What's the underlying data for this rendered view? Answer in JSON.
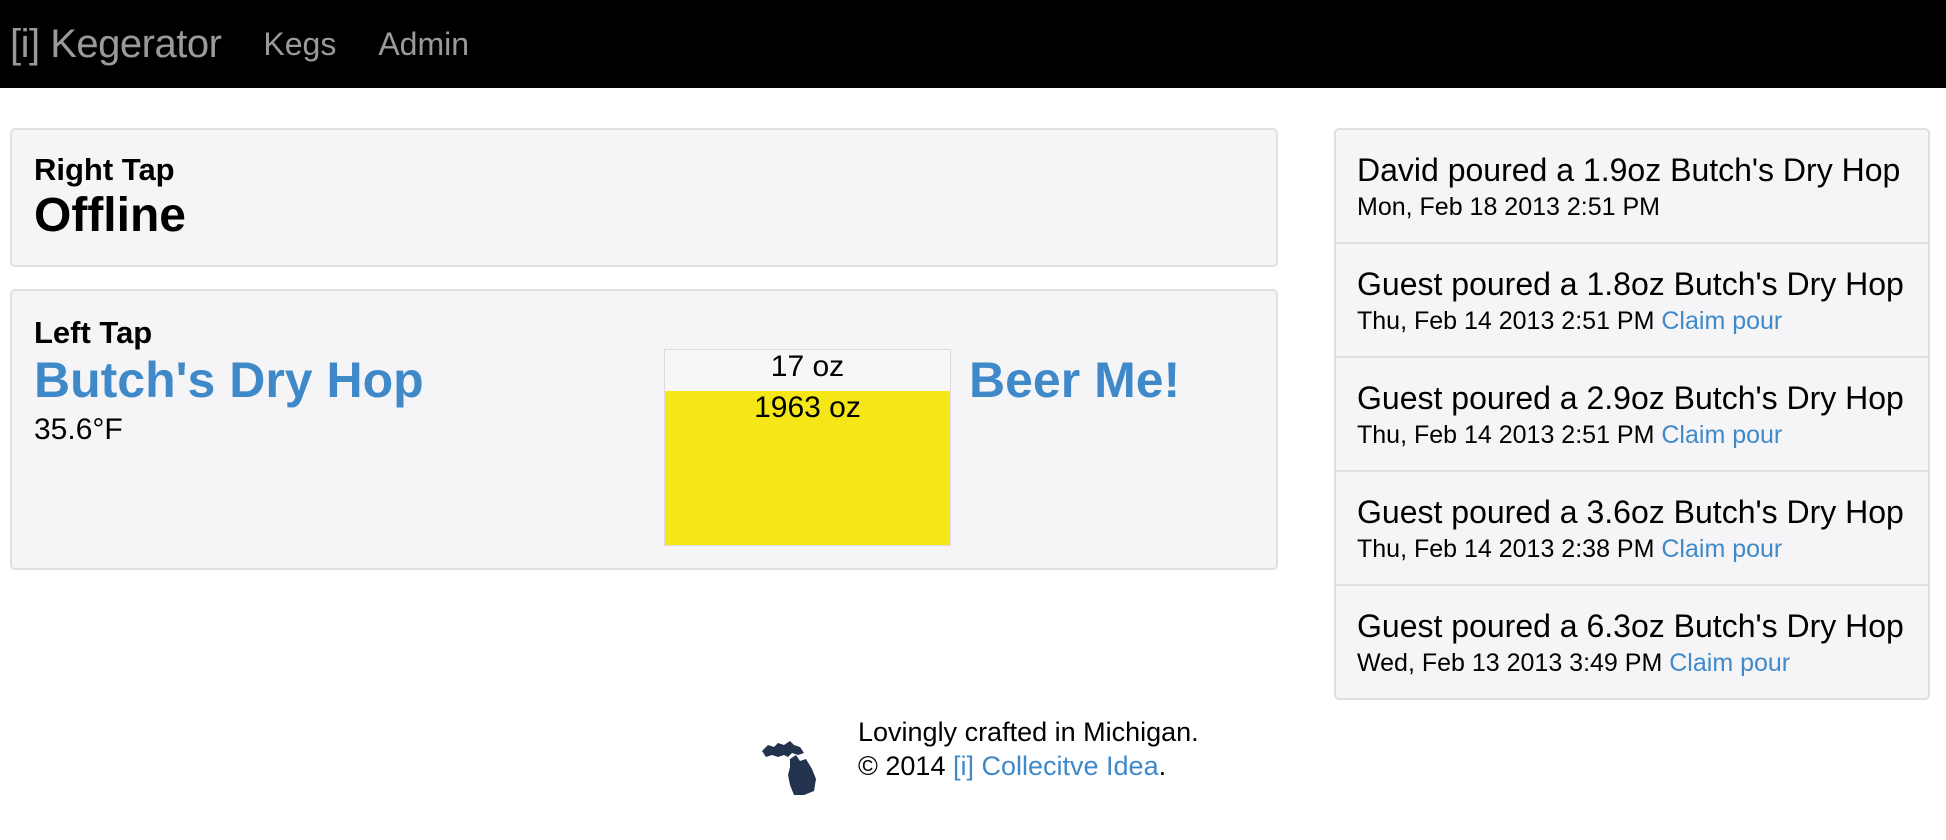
{
  "nav": {
    "brand": "[i] Kegerator",
    "links": [
      "Kegs",
      "Admin"
    ]
  },
  "right_tap": {
    "label": "Right Tap",
    "status": "Offline"
  },
  "left_tap": {
    "label": "Left Tap",
    "beer_name": "Butch's Dry Hop",
    "temperature": "35.6°F",
    "gauge": {
      "poured": "17 oz",
      "remaining": "1963 oz",
      "remaining_fraction": 0.79,
      "fill_color": "#f5e618"
    },
    "action": "Beer Me!"
  },
  "pours": [
    {
      "title": "David poured a 1.9oz Butch's Dry Hop",
      "time": "Mon, Feb 18 2013 2:51 PM",
      "claim": ""
    },
    {
      "title": "Guest poured a 1.8oz Butch's Dry Hop",
      "time": "Thu, Feb 14 2013 2:51 PM",
      "claim": "Claim pour"
    },
    {
      "title": "Guest poured a 2.9oz Butch's Dry Hop",
      "time": "Thu, Feb 14 2013 2:51 PM",
      "claim": "Claim pour"
    },
    {
      "title": "Guest poured a 3.6oz Butch's Dry Hop",
      "time": "Thu, Feb 14 2013 2:38 PM",
      "claim": "Claim pour"
    },
    {
      "title": "Guest poured a 6.3oz Butch's Dry Hop",
      "time": "Wed, Feb 13 2013 3:49 PM",
      "claim": "Claim pour"
    }
  ],
  "footer": {
    "line1": "Lovingly crafted in Michigan.",
    "copyright": "© 2014",
    "link": "[i] Collecitve Idea",
    "suffix": ".",
    "icon": "michigan-icon"
  },
  "colors": {
    "accent": "#4089c9",
    "navbar": "#000000",
    "well": "#f5f5f7"
  }
}
